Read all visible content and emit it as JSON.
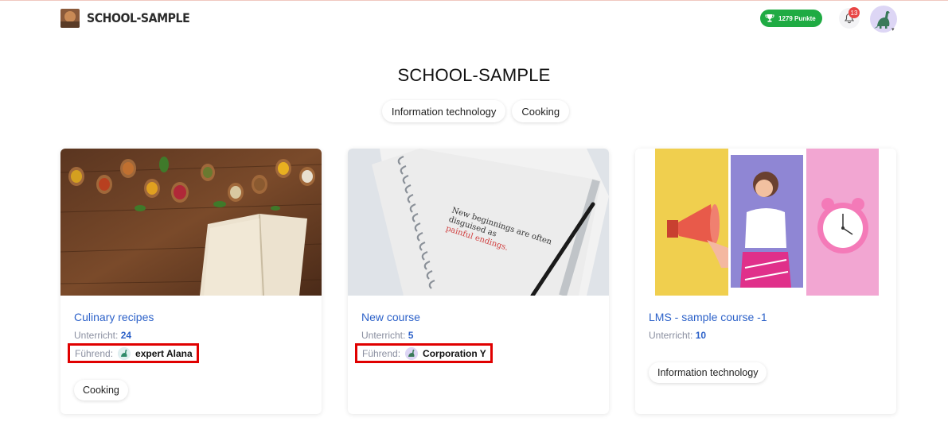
{
  "header": {
    "brand": "SCHOOL-SAMPLE",
    "points": "1279 Punkte",
    "notifications_count": "13"
  },
  "page": {
    "title": "SCHOOL-SAMPLE",
    "categories": [
      "Information technology",
      "Cooking"
    ]
  },
  "courses": [
    {
      "title": "Culinary recipes",
      "lessons_label": "Unterricht:",
      "lessons": "24",
      "leader_label": "Führend:",
      "leader": "expert Alana",
      "tag": "Cooking"
    },
    {
      "title": "New course",
      "lessons_label": "Unterricht:",
      "lessons": "5",
      "leader_label": "Führend:",
      "leader": "Corporation Y",
      "notebook_text": [
        "New beginnings are often",
        "disguised as",
        "painful endings."
      ]
    },
    {
      "title": "LMS - sample course -1",
      "lessons_label": "Unterricht:",
      "lessons": "10",
      "tag": "Information technology"
    }
  ],
  "colors": {
    "accent_link": "#2d62c9",
    "points_green": "#1fab43",
    "badge_red": "#e84545",
    "highlight_red": "#e00000"
  }
}
